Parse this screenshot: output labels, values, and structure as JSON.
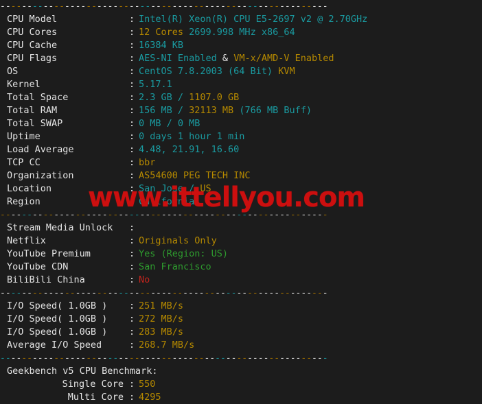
{
  "terminal": {
    "separator_text": "-------------------------------------------------------------",
    "watermark": "www.ittellyou.com",
    "colon": ":",
    "sections": [
      {
        "name": "system-info",
        "rows": [
          {
            "label": "CPU Model",
            "parts": [
              {
                "text": "Intel(R) Xeon(R) CPU E5-2697 v2 @ 2.70GHz",
                "color": "cyan"
              }
            ]
          },
          {
            "label": "CPU Cores",
            "parts": [
              {
                "text": "12 Cores",
                "color": "yellow"
              },
              {
                "text": " 2699.998 MHz x86_64",
                "color": "cyan"
              }
            ]
          },
          {
            "label": "CPU Cache",
            "parts": [
              {
                "text": "16384 KB",
                "color": "cyan"
              }
            ]
          },
          {
            "label": "CPU Flags",
            "parts": [
              {
                "text": "AES-NI Enabled",
                "color": "cyan"
              },
              {
                "text": " & ",
                "color": "white"
              },
              {
                "text": "VM-x/AMD-V Enabled",
                "color": "yellow"
              }
            ]
          },
          {
            "label": "OS",
            "parts": [
              {
                "text": "CentOS 7.8.2003 (64 Bit) ",
                "color": "cyan"
              },
              {
                "text": "KVM",
                "color": "yellow"
              }
            ]
          },
          {
            "label": "Kernel",
            "parts": [
              {
                "text": "5.17.1",
                "color": "cyan"
              }
            ]
          },
          {
            "label": "Total Space",
            "parts": [
              {
                "text": "2.3 GB / ",
                "color": "cyan"
              },
              {
                "text": "1107.0 GB",
                "color": "yellow"
              }
            ]
          },
          {
            "label": "Total RAM",
            "parts": [
              {
                "text": "156 MB / ",
                "color": "cyan"
              },
              {
                "text": "32113 MB",
                "color": "yellow"
              },
              {
                "text": " (766 MB Buff)",
                "color": "cyan"
              }
            ]
          },
          {
            "label": "Total SWAP",
            "parts": [
              {
                "text": "0 MB / 0 MB",
                "color": "cyan"
              }
            ]
          },
          {
            "label": "Uptime",
            "parts": [
              {
                "text": "0 days 1 hour 1 min",
                "color": "cyan"
              }
            ]
          },
          {
            "label": "Load Average",
            "parts": [
              {
                "text": "4.48, 21.91, 16.60",
                "color": "cyan"
              }
            ]
          },
          {
            "label": "TCP CC",
            "parts": [
              {
                "text": "bbr",
                "color": "yellow"
              }
            ]
          },
          {
            "label": "Organization",
            "parts": [
              {
                "text": "AS54600 PEG TECH INC",
                "color": "yellow"
              }
            ]
          },
          {
            "label": "Location",
            "parts": [
              {
                "text": "San Jose / ",
                "color": "cyan"
              },
              {
                "text": "US",
                "color": "yellow"
              }
            ]
          },
          {
            "label": "Region",
            "parts": [
              {
                "text": "California",
                "color": "cyan"
              }
            ]
          }
        ]
      },
      {
        "name": "stream-media-unlock",
        "rows": [
          {
            "label": "Stream Media Unlock",
            "parts": []
          },
          {
            "label": "Netflix",
            "parts": [
              {
                "text": "Originals Only",
                "color": "yellow"
              }
            ]
          },
          {
            "label": "YouTube Premium",
            "parts": [
              {
                "text": "Yes (Region: US)",
                "color": "green"
              }
            ]
          },
          {
            "label": "YouTube CDN",
            "parts": [
              {
                "text": "San Francisco",
                "color": "green"
              }
            ]
          },
          {
            "label": "BiliBili China",
            "parts": [
              {
                "text": "No",
                "color": "red"
              }
            ]
          }
        ]
      },
      {
        "name": "io-speed",
        "rows": [
          {
            "label": "I/O Speed( 1.0GB )",
            "parts": [
              {
                "text": "251 MB/s",
                "color": "yellow"
              }
            ]
          },
          {
            "label": "I/O Speed( 1.0GB )",
            "parts": [
              {
                "text": "272 MB/s",
                "color": "yellow"
              }
            ]
          },
          {
            "label": "I/O Speed( 1.0GB )",
            "parts": [
              {
                "text": "283 MB/s",
                "color": "yellow"
              }
            ]
          },
          {
            "label": "Average I/O Speed",
            "parts": [
              {
                "text": "268.7 MB/s",
                "color": "yellow"
              }
            ]
          }
        ]
      },
      {
        "name": "geekbench",
        "heading": "Geekbench v5 CPU Benchmark:",
        "rows": [
          {
            "label": "Single Core",
            "indent": true,
            "parts": [
              {
                "text": "550",
                "color": "yellow"
              }
            ]
          },
          {
            "label": "Multi Core",
            "indent": true,
            "parts": [
              {
                "text": "4295",
                "color": "yellow"
              }
            ]
          }
        ]
      }
    ]
  },
  "colors": {
    "background": "#1c1c1c",
    "label": "#e4e4e4",
    "cyan": "#1a9ba1",
    "yellow": "#b58900",
    "green": "#2e9b2e",
    "red": "#c4241c",
    "watermark": "#cc0f0f"
  }
}
